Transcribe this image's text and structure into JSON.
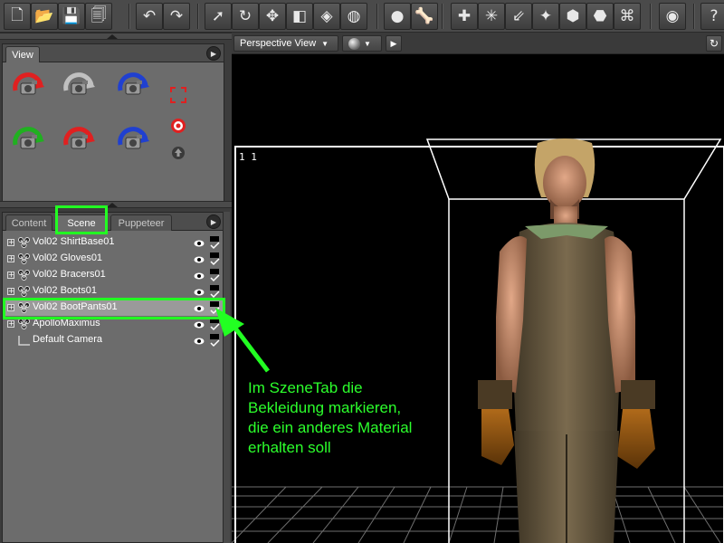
{
  "toolbar": {
    "buttons": [
      {
        "name": "new-file-icon",
        "glyph": "🗋"
      },
      {
        "name": "open-folder-icon",
        "glyph": "📂"
      },
      {
        "name": "save-icon",
        "glyph": "💾"
      },
      {
        "name": "save-as-icon",
        "glyph": "🗐"
      },
      {
        "name": "undo-icon",
        "glyph": "↶"
      },
      {
        "name": "redo-icon",
        "glyph": "↷"
      },
      {
        "name": "select-arrow-icon",
        "glyph": "➚"
      },
      {
        "name": "rotate-icon",
        "glyph": "↻"
      },
      {
        "name": "move-icon",
        "glyph": "✥"
      },
      {
        "name": "scale-icon",
        "glyph": "◧"
      },
      {
        "name": "surface-select-icon",
        "glyph": "◈"
      },
      {
        "name": "render-region-icon",
        "glyph": "◍"
      },
      {
        "name": "render-icon",
        "glyph": "●"
      },
      {
        "name": "bone-icon",
        "glyph": "🦴"
      },
      {
        "name": "create-camera-icon",
        "glyph": "✚"
      },
      {
        "name": "create-light-icon",
        "glyph": "✳"
      },
      {
        "name": "create-distant-light-icon",
        "glyph": "⇙"
      },
      {
        "name": "create-point-light-icon",
        "glyph": "✦"
      },
      {
        "name": "create-primitive-icon",
        "glyph": "⬢"
      },
      {
        "name": "create-shape-icon",
        "glyph": "⬣"
      },
      {
        "name": "create-spotlight-icon",
        "glyph": "⌘"
      },
      {
        "name": "world-icon",
        "glyph": "◉"
      },
      {
        "name": "help-icon",
        "glyph": "?"
      }
    ]
  },
  "view_panel": {
    "tab_label": "View",
    "tools": [
      {
        "name": "orbit-camera-icon"
      },
      {
        "name": "zoom-frame-camera-icon"
      },
      {
        "name": "roll-camera-icon"
      },
      {
        "name": "translate-camera-icon"
      },
      {
        "name": "dolly-camera-icon"
      },
      {
        "name": "pan-camera-icon"
      }
    ],
    "small_tools": [
      {
        "name": "frame-icon"
      },
      {
        "name": "target-icon"
      },
      {
        "name": "home-icon"
      }
    ]
  },
  "scene_panel": {
    "tabs": [
      "Content",
      "Scene",
      "Puppeteer"
    ],
    "active_tab": "Scene",
    "items": [
      {
        "label": "Vol02 ShirtBase01",
        "expand": "+",
        "selected": false
      },
      {
        "label": "Vol02 Gloves01",
        "expand": "+",
        "selected": false
      },
      {
        "label": "Vol02 Bracers01",
        "expand": "+",
        "selected": false
      },
      {
        "label": "Vol02 Boots01",
        "expand": "+",
        "selected": false
      },
      {
        "label": "Vol02 BootPants01",
        "expand": "+",
        "selected": true
      },
      {
        "label": "ApolloMaximus",
        "expand": "+",
        "selected": false
      },
      {
        "label": "Default Camera",
        "expand": "",
        "selected": false
      }
    ]
  },
  "viewport": {
    "view_label": "Perspective View",
    "overlay_text": "1  1"
  },
  "annotation": {
    "text": "Im SzeneTab die\nBekleidung markieren,\ndie ein anderes Material\nerhalten soll",
    "color": "#22ff22"
  }
}
